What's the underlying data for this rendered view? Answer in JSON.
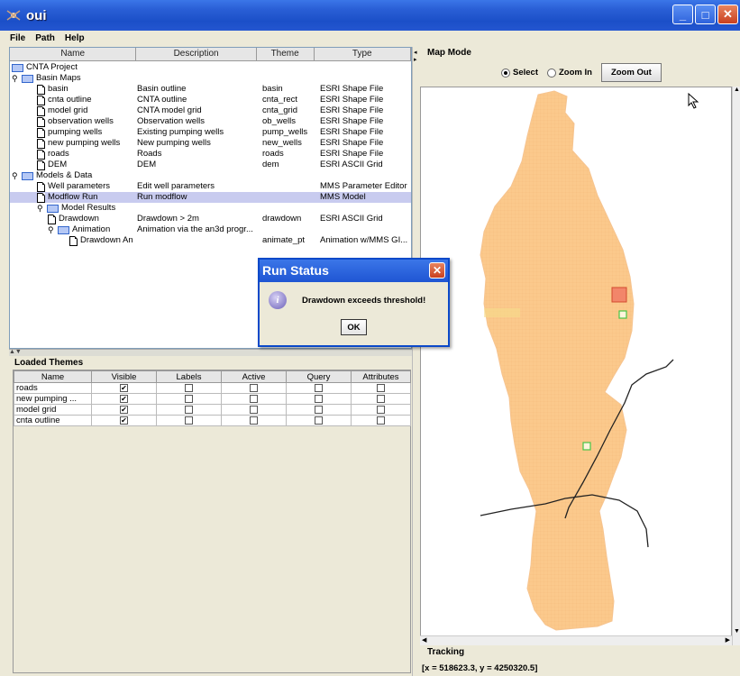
{
  "window": {
    "title": "oui"
  },
  "menu": {
    "items": [
      "File",
      "Path",
      "Help"
    ]
  },
  "tree": {
    "columns": [
      "Name",
      "Description",
      "Theme",
      "Type"
    ],
    "rows": [
      {
        "name": "CNTA Project",
        "desc": "",
        "theme": "",
        "type": "",
        "level": 0,
        "icon": "folder",
        "pin": false
      },
      {
        "name": "Basin Maps",
        "desc": "",
        "theme": "",
        "type": "",
        "level": 1,
        "icon": "folder",
        "pin": true
      },
      {
        "name": "basin",
        "desc": "Basin outline",
        "theme": "basin",
        "type": "ESRI Shape File",
        "level": 2,
        "icon": "doc"
      },
      {
        "name": "cnta outline",
        "desc": "CNTA outline",
        "theme": "cnta_rect",
        "type": "ESRI Shape File",
        "level": 2,
        "icon": "doc"
      },
      {
        "name": "model grid",
        "desc": "CNTA model grid",
        "theme": "cnta_grid",
        "type": "ESRI Shape File",
        "level": 2,
        "icon": "doc"
      },
      {
        "name": "observation wells",
        "desc": "Observation wells",
        "theme": "ob_wells",
        "type": "ESRI Shape File",
        "level": 2,
        "icon": "doc"
      },
      {
        "name": "pumping wells",
        "desc": "Existing pumping wells",
        "theme": "pump_wells",
        "type": "ESRI Shape File",
        "level": 2,
        "icon": "doc"
      },
      {
        "name": "new pumping wells",
        "desc": "New pumping wells",
        "theme": "new_wells",
        "type": "ESRI Shape File",
        "level": 2,
        "icon": "doc"
      },
      {
        "name": "roads",
        "desc": "Roads",
        "theme": "roads",
        "type": "ESRI Shape File",
        "level": 2,
        "icon": "doc"
      },
      {
        "name": "DEM",
        "desc": "DEM",
        "theme": "dem",
        "type": "ESRI ASCII Grid",
        "level": 2,
        "icon": "doc"
      },
      {
        "name": "Models & Data",
        "desc": "",
        "theme": "",
        "type": "",
        "level": 1,
        "icon": "folder",
        "pin": true
      },
      {
        "name": "Well parameters",
        "desc": "Edit well parameters",
        "theme": "",
        "type": "MMS Parameter Editor",
        "level": 2,
        "icon": "doc"
      },
      {
        "name": "Modflow Run",
        "desc": "Run modflow",
        "theme": "",
        "type": "MMS Model",
        "level": 2,
        "icon": "doc",
        "selected": true
      },
      {
        "name": "Model Results",
        "desc": "",
        "theme": "",
        "type": "",
        "level": 2,
        "icon": "folder",
        "pin": true
      },
      {
        "name": "Drawdown",
        "desc": "Drawdown > 2m",
        "theme": "drawdown",
        "type": "ESRI ASCII Grid",
        "level": 3,
        "icon": "doc"
      },
      {
        "name": "Animation",
        "desc": "Animation via the an3d progr...",
        "theme": "",
        "type": "",
        "level": 3,
        "icon": "folder",
        "pin": true
      },
      {
        "name": "Drawdown An",
        "desc": "",
        "theme": "animate_pt",
        "type": "Animation w/MMS GI...",
        "level": 4,
        "icon": "doc"
      }
    ]
  },
  "themes": {
    "title": "Loaded Themes",
    "columns": [
      "Name",
      "Visible",
      "Labels",
      "Active",
      "Query",
      "Attributes"
    ],
    "rows": [
      {
        "name": "roads",
        "visible": true
      },
      {
        "name": "new pumping ...",
        "visible": true
      },
      {
        "name": "model grid",
        "visible": true
      },
      {
        "name": "cnta outline",
        "visible": true
      }
    ]
  },
  "map": {
    "mode_label": "Map Mode",
    "select_label": "Select",
    "zoom_in_label": "Zoom In",
    "zoom_out_label": "Zoom Out",
    "tracking_label": "Tracking",
    "tracking_value": "[x = 518623.3,   y = 4250320.5]",
    "fill_color": "#fbc98c"
  },
  "dialog": {
    "title": "Run Status",
    "message": "Drawdown exceeds threshold!",
    "ok_label": "OK",
    "close_label": "X"
  }
}
